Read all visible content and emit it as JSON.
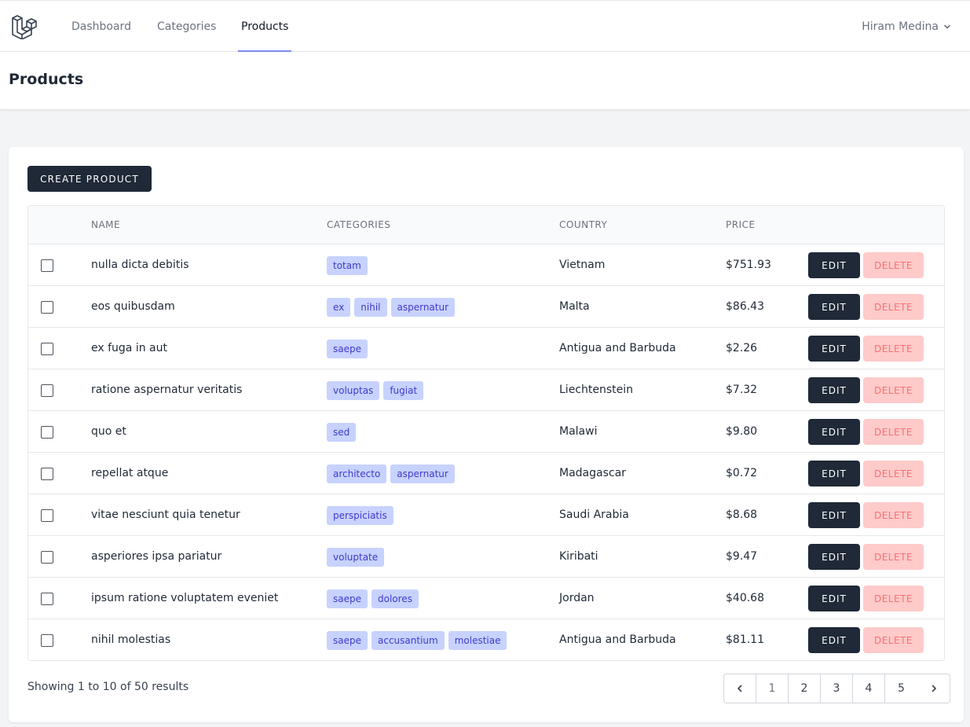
{
  "nav": {
    "links": [
      {
        "label": "Dashboard"
      },
      {
        "label": "Categories"
      },
      {
        "label": "Products",
        "active": true
      }
    ],
    "user": "Hiram Medina"
  },
  "header": {
    "title": "Products"
  },
  "toolbar": {
    "create_label": "CREATE PRODUCT"
  },
  "table": {
    "headers": {
      "name": "NAME",
      "categories": "CATEGORIES",
      "country": "COUNTRY",
      "price": "PRICE"
    },
    "edit_label": "EDIT",
    "delete_label": "DELETE",
    "rows": [
      {
        "name": "nulla dicta debitis",
        "categories": [
          "totam"
        ],
        "country": "Vietnam",
        "price": "$751.93"
      },
      {
        "name": "eos quibusdam",
        "categories": [
          "ex",
          "nihil",
          "aspernatur"
        ],
        "country": "Malta",
        "price": "$86.43"
      },
      {
        "name": "ex fuga in aut",
        "categories": [
          "saepe"
        ],
        "country": "Antigua and Barbuda",
        "price": "$2.26"
      },
      {
        "name": "ratione aspernatur veritatis",
        "categories": [
          "voluptas",
          "fugiat"
        ],
        "country": "Liechtenstein",
        "price": "$7.32"
      },
      {
        "name": "quo et",
        "categories": [
          "sed"
        ],
        "country": "Malawi",
        "price": "$9.80"
      },
      {
        "name": "repellat atque",
        "categories": [
          "architecto",
          "aspernatur"
        ],
        "country": "Madagascar",
        "price": "$0.72"
      },
      {
        "name": "vitae nesciunt quia tenetur",
        "categories": [
          "perspiciatis"
        ],
        "country": "Saudi Arabia",
        "price": "$8.68"
      },
      {
        "name": "asperiores ipsa pariatur",
        "categories": [
          "voluptate"
        ],
        "country": "Kiribati",
        "price": "$9.47"
      },
      {
        "name": "ipsum ratione voluptatem eveniet",
        "categories": [
          "saepe",
          "dolores"
        ],
        "country": "Jordan",
        "price": "$40.68"
      },
      {
        "name": "nihil molestias",
        "categories": [
          "saepe",
          "accusantium",
          "molestiae"
        ],
        "country": "Antigua and Barbuda",
        "price": "$81.11"
      }
    ]
  },
  "pagination": {
    "summary": "Showing 1 to 10 of 50 results",
    "pages": [
      "1",
      "2",
      "3",
      "4",
      "5"
    ],
    "current": "1"
  },
  "icons": {
    "logo": "laravel-logo-icon",
    "user_menu": "chevron-down-icon",
    "prev": "chevron-left-icon",
    "next": "chevron-right-icon"
  }
}
